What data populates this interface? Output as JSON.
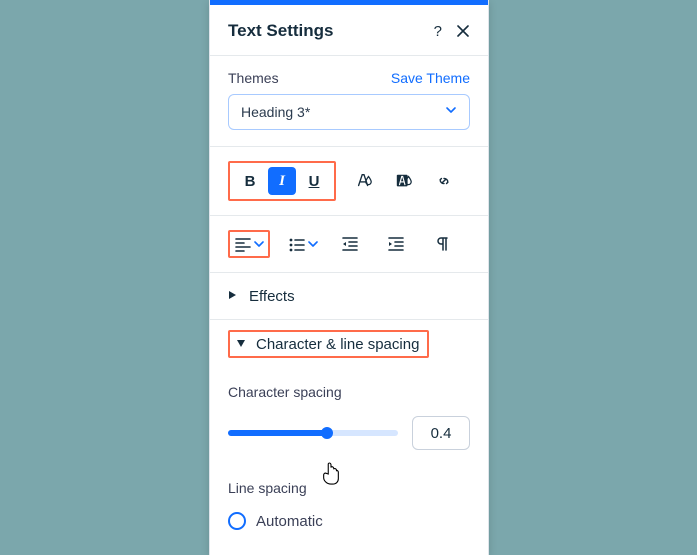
{
  "header": {
    "title": "Text Settings"
  },
  "themes": {
    "label": "Themes",
    "save_link": "Save Theme",
    "selected": "Heading 3*"
  },
  "style_tools": {
    "bold_glyph": "B",
    "italic_glyph": "I",
    "underline_glyph": "U"
  },
  "accordions": {
    "effects": "Effects",
    "spacing": "Character & line spacing"
  },
  "char_spacing": {
    "label": "Character spacing",
    "value": "0.4"
  },
  "line_spacing": {
    "label": "Line spacing",
    "option_auto": "Automatic"
  }
}
